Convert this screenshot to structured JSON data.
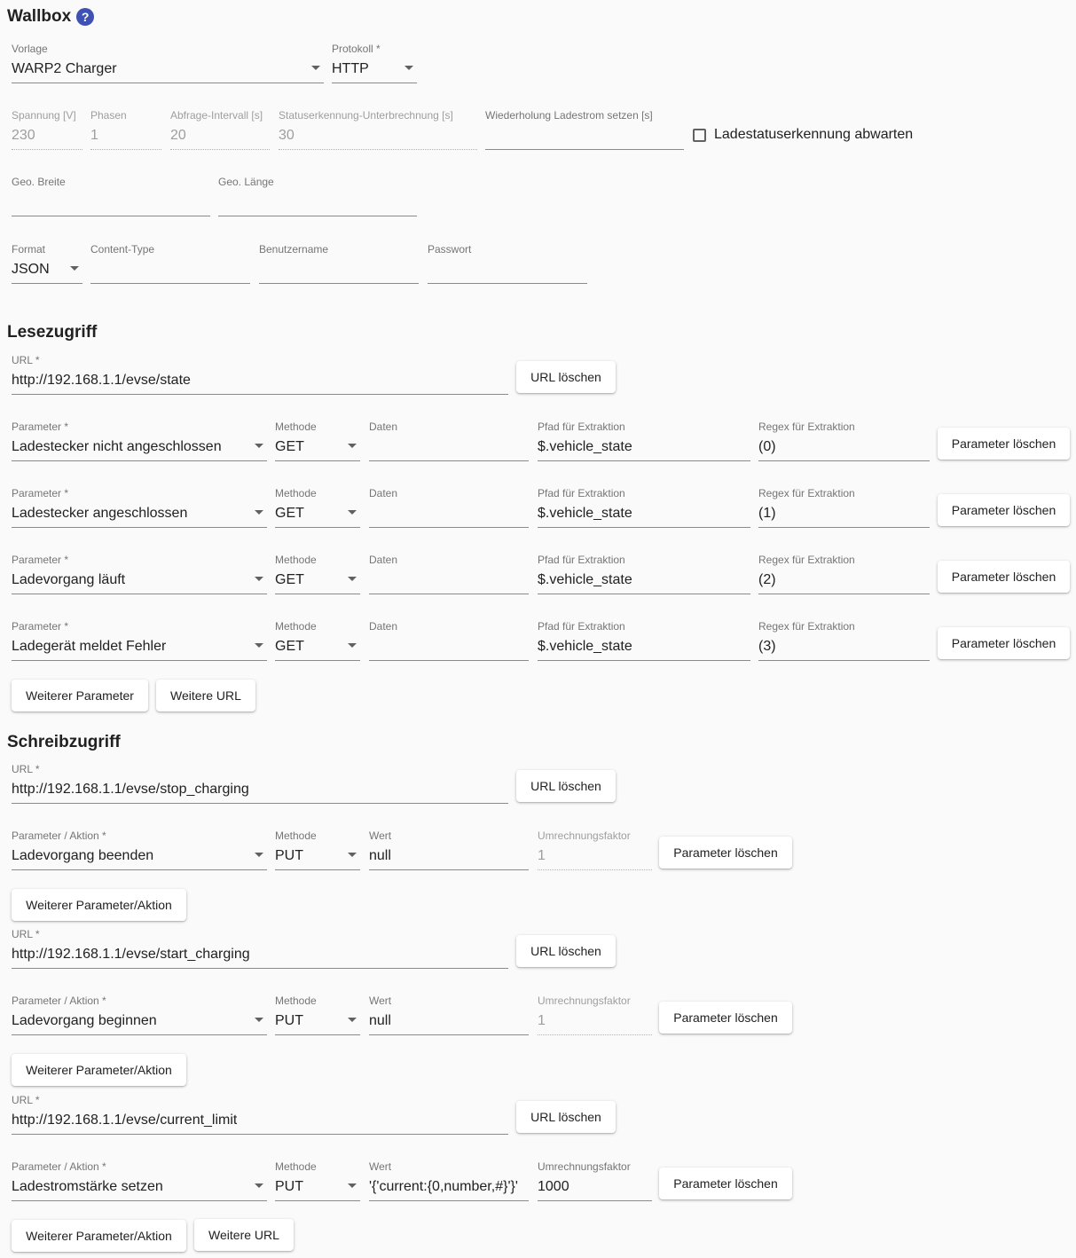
{
  "header": {
    "title": "Wallbox",
    "help_icon": "?"
  },
  "general": {
    "vorlage": {
      "label": "Vorlage",
      "value": "WARP2 Charger"
    },
    "protokoll": {
      "label": "Protokoll *",
      "value": "HTTP"
    },
    "spannung": {
      "label": "Spannung [V]",
      "value": "230"
    },
    "phasen": {
      "label": "Phasen",
      "value": "1"
    },
    "abfrage": {
      "label": "Abfrage-Intervall [s]",
      "value": "20"
    },
    "status_unterbrechung": {
      "label": "Statuserkennung-Unterbrechnung [s]",
      "value": "30"
    },
    "wiederholung": {
      "label": "Wiederholung Ladestrom setzen [s]",
      "value": ""
    },
    "ladestatus_checkbox": {
      "label": "Ladestatuserkennung abwarten",
      "checked": false
    },
    "geo_breite": {
      "label": "Geo. Breite",
      "value": ""
    },
    "geo_laenge": {
      "label": "Geo. Länge",
      "value": ""
    },
    "format": {
      "label": "Format",
      "value": "JSON"
    },
    "content_type": {
      "label": "Content-Type",
      "value": ""
    },
    "benutzername": {
      "label": "Benutzername",
      "value": ""
    },
    "passwort": {
      "label": "Passwort",
      "value": ""
    }
  },
  "lesezugriff": {
    "title": "Lesezugriff",
    "url_label": "URL *",
    "url_value": "http://192.168.1.1/evse/state",
    "url_delete": "URL löschen",
    "labels": {
      "parameter": "Parameter *",
      "methode": "Methode",
      "daten": "Daten",
      "pfad": "Pfad für Extraktion",
      "regex": "Regex für Extraktion"
    },
    "param_delete": "Parameter löschen",
    "rows": [
      {
        "parameter": "Ladestecker nicht angeschlossen",
        "methode": "GET",
        "daten": "",
        "pfad": "$.vehicle_state",
        "regex": "(0)"
      },
      {
        "parameter": "Ladestecker angeschlossen",
        "methode": "GET",
        "daten": "",
        "pfad": "$.vehicle_state",
        "regex": "(1)"
      },
      {
        "parameter": "Ladevorgang läuft",
        "methode": "GET",
        "daten": "",
        "pfad": "$.vehicle_state",
        "regex": "(2)"
      },
      {
        "parameter": "Ladegerät meldet Fehler",
        "methode": "GET",
        "daten": "",
        "pfad": "$.vehicle_state",
        "regex": "(3)"
      }
    ],
    "more_param": "Weiterer Parameter",
    "more_url": "Weitere URL"
  },
  "schreibzugriff": {
    "title": "Schreibzugriff",
    "labels": {
      "url": "URL *",
      "parameter": "Parameter / Aktion *",
      "methode": "Methode",
      "wert": "Wert",
      "faktor": "Umrechnungsfaktor"
    },
    "url_delete": "URL löschen",
    "param_delete": "Parameter löschen",
    "more_param": "Weiterer Parameter/Aktion",
    "more_url": "Weitere URL",
    "blocks": [
      {
        "url": "http://192.168.1.1/evse/stop_charging",
        "parameter": "Ladevorgang beenden",
        "methode": "PUT",
        "wert": "null",
        "faktor": "1"
      },
      {
        "url": "http://192.168.1.1/evse/start_charging",
        "parameter": "Ladevorgang beginnen",
        "methode": "PUT",
        "wert": "null",
        "faktor": "1"
      },
      {
        "url": "http://192.168.1.1/evse/current_limit",
        "parameter": "Ladestromstärke setzen",
        "methode": "PUT",
        "wert": "'{'current:{0,number,#}'}'",
        "faktor": "1000"
      }
    ]
  }
}
